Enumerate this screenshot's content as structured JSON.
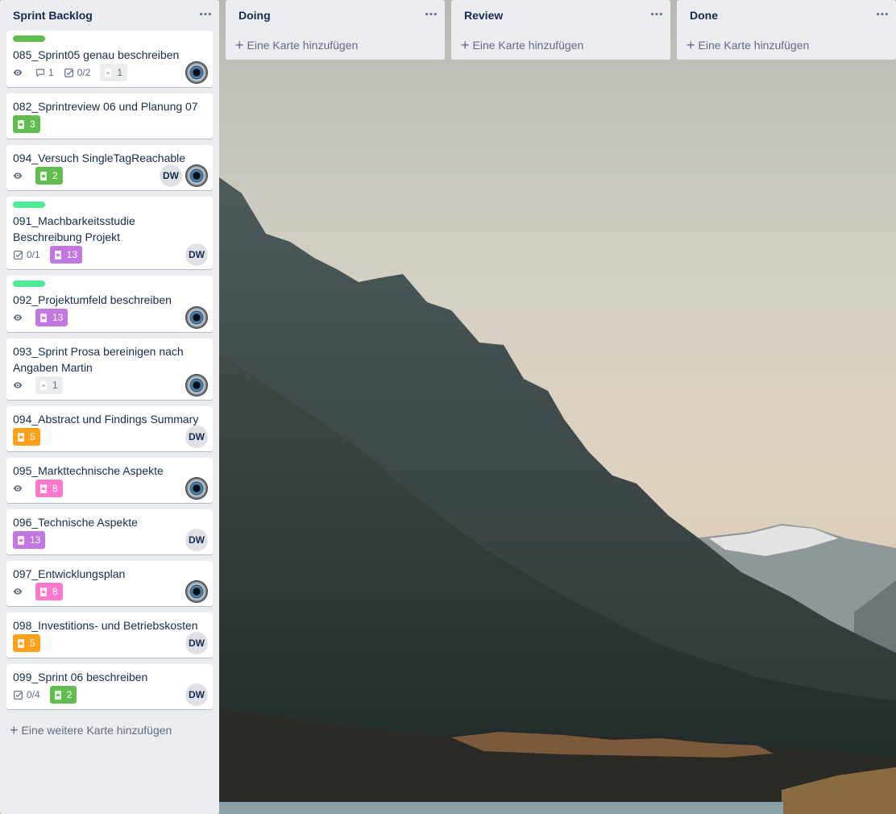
{
  "colors": {
    "list_bg": "#ebecf0",
    "card_bg": "#ffffff",
    "text_primary": "#172b4d",
    "text_secondary": "#5e6c84",
    "label_green": "#61bd4f",
    "label_teal_green": "#51e898",
    "points_green": "#61bd4f",
    "points_purple": "#c377e0",
    "points_orange": "#ff9f1a",
    "points_pink": "#ff78cb"
  },
  "lists": [
    {
      "title": "Sprint Backlog",
      "menu": "⋯",
      "add_label": "Eine weitere Karte hinzufügen",
      "cards": [
        {
          "title": "085_Sprint05 genau beschreiben",
          "label_color": "#61bd4f",
          "watch": true,
          "comments": "1",
          "checklist": "0/2",
          "points": "1",
          "points_color": "grey",
          "members": [
            "eye-avatar"
          ]
        },
        {
          "title": "082_Sprintreview 06 und Planung 07",
          "points": "3",
          "points_color": "green",
          "members": []
        },
        {
          "title": "094_Versuch SingleTagReachable",
          "watch": true,
          "points": "2",
          "points_color": "green",
          "members": [
            "DW",
            "eye-avatar"
          ]
        },
        {
          "title": "091_Machbarkeitsstudie Beschreibung Projekt",
          "label_color": "#51e898",
          "checklist": "0/1",
          "points": "13",
          "points_color": "purple",
          "members": [
            "DW"
          ]
        },
        {
          "title": "092_Projektumfeld beschreiben",
          "label_color": "#51e898",
          "watch": true,
          "points": "13",
          "points_color": "purple",
          "members": [
            "eye-avatar"
          ]
        },
        {
          "title": "093_Sprint Prosa bereinigen nach Angaben Martin",
          "watch": true,
          "points": "1",
          "points_color": "grey",
          "members": [
            "eye-avatar"
          ]
        },
        {
          "title": "094_Abstract und Findings Summary",
          "points": "5",
          "points_color": "orange",
          "members": [
            "DW"
          ]
        },
        {
          "title": "095_Markttechnische Aspekte",
          "watch": true,
          "points": "8",
          "points_color": "pink",
          "members": [
            "eye-avatar"
          ]
        },
        {
          "title": "096_Technische Aspekte",
          "points": "13",
          "points_color": "purple",
          "members": [
            "DW"
          ]
        },
        {
          "title": "097_Entwicklungsplan",
          "watch": true,
          "points": "8",
          "points_color": "pink",
          "members": [
            "eye-avatar"
          ]
        },
        {
          "title": "098_Investitions- und Betriebskosten",
          "points": "5",
          "points_color": "orange",
          "members": [
            "DW"
          ]
        },
        {
          "title": "099_Sprint 06 beschreiben",
          "checklist": "0/4",
          "points": "2",
          "points_color": "green",
          "members": [
            "DW"
          ]
        }
      ]
    },
    {
      "title": "Doing",
      "menu": "⋯",
      "add_label": "Eine Karte hinzufügen",
      "cards": []
    },
    {
      "title": "Review",
      "menu": "⋯",
      "add_label": "Eine Karte hinzufügen",
      "cards": []
    },
    {
      "title": "Done",
      "menu": "⋯",
      "add_label": "Eine Karte hinzufügen",
      "cards": []
    }
  ]
}
